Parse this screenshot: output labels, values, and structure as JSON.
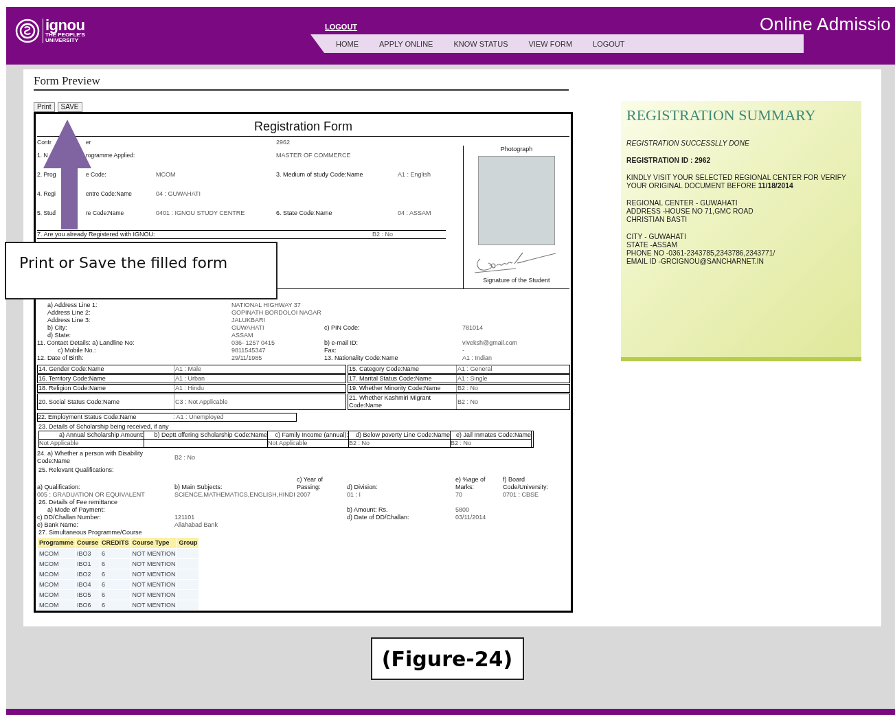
{
  "header": {
    "logo": {
      "wordmark": "ignou",
      "tagline": [
        "THE PEOPLE'S",
        "UNIVERSITY"
      ]
    },
    "top_link": "LOGOUT",
    "nav": [
      "HOME",
      "APPLY ONLINE",
      "KNOW STATUS",
      "VIEW FORM",
      "LOGOUT"
    ],
    "title": "Online Admissio"
  },
  "form_preview": {
    "heading": "Form Preview",
    "buttons": [
      "Print",
      "SAVE"
    ],
    "form": {
      "title": "Registration Form",
      "top_rows": [
        {
          "kind": "wide",
          "label": [
            "Contr",
            "er"
          ],
          "value": "2962"
        },
        {
          "kind": "wide",
          "label": [
            "1. N",
            "rogramme Applied:"
          ],
          "value": "MASTER OF COMMERCE"
        },
        {
          "kind": "pair",
          "label": [
            "2. Prog",
            "e Code:"
          ],
          "value": "MCOM",
          "label2": "3. Medium of study Code:Name",
          "value2": "A1 : English"
        },
        {
          "kind": "pair",
          "label": [
            "4. Regi",
            "entre Code:Name"
          ],
          "value": "04 : GUWAHATI"
        },
        {
          "kind": "pair",
          "label": [
            "5. Stud",
            "re Code:Name"
          ],
          "value": "0401 : IGNOU STUDY CENTRE",
          "label2": "6. State Code:Name",
          "value2": "04 : ASSAM"
        }
      ],
      "registered": {
        "label": "7. Are you already Registered with IGNOU:",
        "value": "B2 : No"
      },
      "photo": {
        "label": "Photograph",
        "signature_label": "Signature of the Student"
      },
      "address_rows": [
        {
          "kind": "sub",
          "label": "a) Address Line 1:",
          "value": "NATIONAL HIGHWAY 37"
        },
        {
          "kind": "sub",
          "label": "Address Line 2:",
          "value": "GOPINATH BORDOLOI NAGAR"
        },
        {
          "kind": "sub",
          "label": "Address Line 3:",
          "value": "JALUKBARI"
        },
        {
          "kind": "sub",
          "label": "b) City:",
          "value": "GUWAHATI",
          "label2": "c) PIN Code:",
          "value2": "781014"
        },
        {
          "kind": "sub",
          "label": "d) State:",
          "value": "ASSAM"
        },
        {
          "kind": "main",
          "label": "11. Contact Details: a) Landline No:",
          "value": "036- 1257 0415",
          "label2": "b) e-mail ID:",
          "value2": "viveksh@gmail.com"
        },
        {
          "kind": "subsub",
          "label": "c) Mobile No.:",
          "value": "9811545347",
          "label2": "Fax:",
          "value2": "-"
        },
        {
          "kind": "main",
          "label": "12. Date of Birth:",
          "value": "29/11/1985",
          "label2": "13. Nationality Code:Name",
          "value2": "A1 : Indian"
        }
      ],
      "code_rows": [
        {
          "label": "14. Gender Code:Name",
          "value": "A1 : Male",
          "label2": "15. Category Code:Name",
          "value2": "A1 : General"
        },
        {
          "label": "16. Territory Code:Name",
          "value": "A1 : Urban",
          "label2": "17. Marital Status Code:Name",
          "value2": "A1 : Single"
        },
        {
          "label": "18. Religion Code:Name",
          "value": "A1 : Hindu",
          "label2": "19. Whether Minority Code:Name",
          "value2": "B2 : No"
        },
        {
          "label": "20. Social Status Code:Name",
          "value": "C3 : Not Applicable",
          "label2": "21. Whether Kashmiri Migrant Code:Name",
          "value2": "B2 : No"
        }
      ],
      "employment": {
        "label": "22. Employment Status Code:Name",
        "value": ": A1 : Unemployed"
      },
      "scholarship": {
        "heading": "23. Details of Scholarship being received, if any",
        "columns": [
          {
            "header": "a) Annual Scholarship Amount:",
            "value": "Not Applicable"
          },
          {
            "header": "b) Deptt offering Scholarship Code:Name"
          },
          {
            "header": "c) Family Income (annual):",
            "value": "Not Applicable"
          },
          {
            "header": "d) Below poverty Line Code:Name",
            "value": "B2 : No"
          },
          {
            "header": "e) Jail Inmates Code:Name",
            "value": "B2 : No"
          }
        ]
      },
      "disability": {
        "label": "24. a) Whether a person with Disability Code:Name",
        "value": "B2 : No"
      },
      "qualifications": {
        "heading": "25. Relevant Qualifications:",
        "columns": [
          {
            "header": "a) Qualification:",
            "value": "005 : GRADUATION OR EQUIVALENT"
          },
          {
            "header": "b) Main Subjects:",
            "value": "SCIENCE,MATHEMATICS,ENGLISH,HINDI"
          },
          {
            "header": "c) Year of Passing:",
            "value": "2007"
          },
          {
            "header": "d) Division:",
            "value": "01 : I"
          },
          {
            "header": "e) %age of Marks:",
            "value": "70"
          },
          {
            "header": "f) Board Code/University:",
            "value": "0701 : CBSE"
          }
        ]
      },
      "fee": {
        "heading": "26. Details of Fee remittance",
        "rows": [
          {
            "kind": "sub",
            "label": "a) Mode of Payment:",
            "label2": "b) Amount: Rs.",
            "value2": "5800"
          },
          {
            "kind": "main",
            "label": "c) DD/Challan Number:",
            "value": "121101",
            "label2": "d) Date of DD/Challan:",
            "value2": "03/11/2014"
          },
          {
            "kind": "main",
            "label": "e) Bank Name:",
            "value": "Allahabad Bank"
          }
        ]
      },
      "courses": {
        "heading": "27. Simultaneous Programme/Course",
        "columns": [
          "Programme",
          "Course",
          "CREDITS",
          "Course Type",
          "Group"
        ],
        "rows": [
          [
            "MCOM",
            "IBO3",
            "6",
            "NOT MENTION"
          ],
          [
            "MCOM",
            "IBO1",
            "6",
            "NOT MENTION"
          ],
          [
            "MCOM",
            "IBO2",
            "6",
            "NOT MENTION"
          ],
          [
            "MCOM",
            "IBO4",
            "6",
            "NOT MENTION"
          ],
          [
            "MCOM",
            "IBO5",
            "6",
            "NOT MENTION"
          ],
          [
            "MCOM",
            "IBO6",
            "6",
            "NOT MENTION"
          ]
        ]
      }
    }
  },
  "summary": {
    "title": "REGISTRATION SUMMARY",
    "items": [
      {
        "kind": "italic",
        "text": "REGISTRATION SUCCESSLLY DONE"
      },
      {
        "kind": "rich",
        "text": "**REGISTRATION ID : 2962**"
      },
      {
        "kind": "rich",
        "text": "KINDLY VISIT YOUR SELECTED REGIONAL CENTER FOR VERIFY YOUR ORIGINAL DOCUMENT BEFORE **11/18/2014**"
      },
      {
        "kind": "lines",
        "lines": [
          "REGIONAL CENTER - GUWAHATI",
          "ADDRESS -HOUSE NO 71,GMC ROAD",
          "CHRISTIAN BASTI"
        ]
      },
      {
        "kind": "lines",
        "lines": [
          "CITY - GUWAHATI",
          "STATE -ASSAM",
          "PHONE NO -0361-2343785,2343786,2343771/",
          "EMAIL ID -GRCIGNOU@SANCHARNET.IN"
        ]
      }
    ]
  },
  "annotation": {
    "callout": "Print or Save the filled form",
    "caption": "(Figure-24)"
  }
}
